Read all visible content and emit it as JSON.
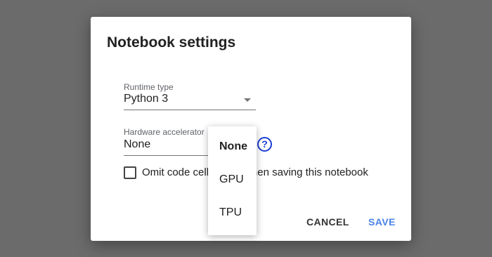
{
  "dialog": {
    "title": "Notebook settings",
    "runtime": {
      "label": "Runtime type",
      "value": "Python 3",
      "caret_icon": "dropdown-arrow-icon"
    },
    "accelerator": {
      "label": "Hardware accelerator",
      "value": "None",
      "help_icon": "help-circle-icon",
      "help_glyph": "?",
      "options": [
        {
          "label": "None",
          "selected": true
        },
        {
          "label": "GPU",
          "selected": false
        },
        {
          "label": "TPU",
          "selected": false
        }
      ]
    },
    "omit_output": {
      "label": "Omit code cell output when saving this notebook",
      "checked": false
    },
    "buttons": {
      "cancel": "CANCEL",
      "save": "SAVE"
    }
  },
  "colors": {
    "backdrop": "#6b6b6b",
    "accent": "#4a82e8",
    "help_icon": "#1a3ed4"
  }
}
